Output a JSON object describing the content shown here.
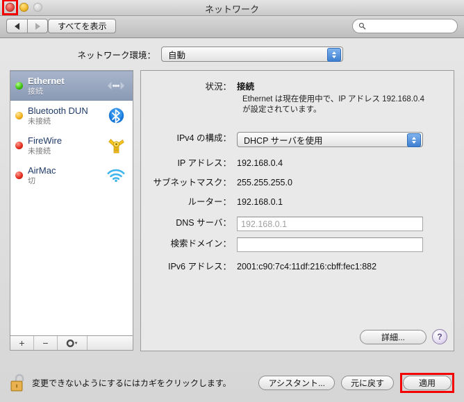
{
  "window": {
    "title": "ネットワーク",
    "traffic": {
      "close": "close-button",
      "minimize": "minimize-button",
      "zoom": "zoom-button"
    }
  },
  "toolbar": {
    "back_label": "戻る",
    "forward_label": "進む",
    "show_all_label": "すべてを表示",
    "search_value": "",
    "search_placeholder": ""
  },
  "environment": {
    "label": "ネットワーク環境：",
    "selected": "自動"
  },
  "services": [
    {
      "name": "Ethernet",
      "state": "接続",
      "dot": "green",
      "icon": "ethernet-icon",
      "selected": true
    },
    {
      "name": "Bluetooth DUN",
      "state": "未接続",
      "dot": "amber",
      "icon": "bluetooth-icon",
      "selected": false
    },
    {
      "name": "FireWire",
      "state": "未接続",
      "dot": "red",
      "icon": "firewire-icon",
      "selected": false
    },
    {
      "name": "AirMac",
      "state": "切",
      "dot": "red",
      "icon": "airport-icon",
      "selected": false
    }
  ],
  "list_tools": {
    "add": "+",
    "remove": "−",
    "actions": "gear"
  },
  "detail": {
    "status_label": "状況：",
    "status_value": "接続",
    "status_hint": "Ethernet は現在使用中で、IP アドレス 192.168.0.4 が設定されています。",
    "ipv4_label": "IPv4 の構成：",
    "ipv4_value": "DHCP サーバを使用",
    "ip_label": "IP アドレス：",
    "ip_value": "192.168.0.4",
    "subnet_label": "サブネットマスク：",
    "subnet_value": "255.255.255.0",
    "router_label": "ルーター：",
    "router_value": "192.168.0.1",
    "dns_label": "DNS サーバ：",
    "dns_value": "192.168.0.1",
    "search_domain_label": "検索ドメイン：",
    "search_domain_value": "",
    "ipv6_label": "IPv6 アドレス：",
    "ipv6_value": "2001:c90:7c4:11df:216:cbff:fec1:882",
    "advanced_label": "詳細...",
    "help_label": "?"
  },
  "footer": {
    "lock_text": "変更できないようにするにはカギをクリックします。",
    "assistant_label": "アシスタント...",
    "revert_label": "元に戻す",
    "apply_label": "適用"
  },
  "colors": {
    "highlight_box": "#f40000",
    "selection": "#8b9ab5",
    "link_text": "#1e3a68"
  }
}
